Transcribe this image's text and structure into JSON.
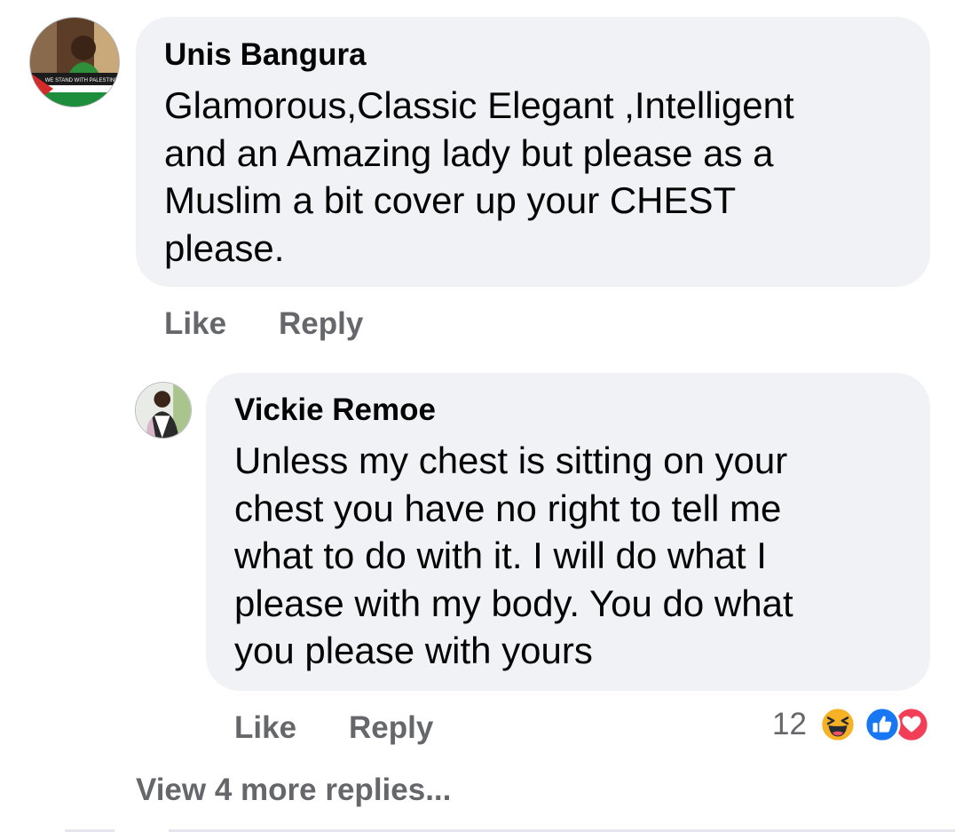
{
  "comment": {
    "author": "Unis Bangura",
    "avatar_caption": "WE STAND WITH PALESTINE",
    "text_lines": [
      "Glamorous,Classic Elegant ,Intelligent",
      "and an Amazing lady but please as a",
      "Muslim a bit cover up your CHEST",
      "please."
    ],
    "like_label": "Like",
    "reply_label": "Reply"
  },
  "reply": {
    "author": "Vickie Remoe",
    "text_lines": [
      "Unless my chest is sitting on your",
      "chest you have no right to tell me",
      "what to do with it. I will do what I",
      "please with my body. You do what",
      "you please with yours"
    ],
    "like_label": "Like",
    "reply_label": "Reply",
    "reaction_count": "12",
    "reaction_icons": [
      "haha-icon",
      "like-icon",
      "love-icon"
    ]
  },
  "view_more_label": "View 4 more replies...",
  "colors": {
    "bubble": "#f0f2f5",
    "text": "#050505",
    "secondary": "#65676b",
    "like_blue": "#1877f2",
    "love_red": "#f33e58",
    "haha_yellow": "#f7b125"
  }
}
